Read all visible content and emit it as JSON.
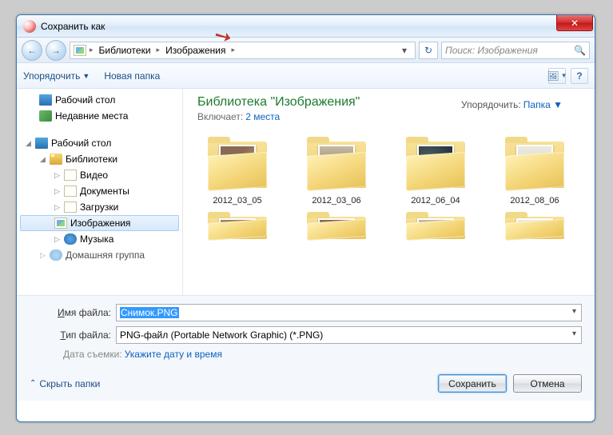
{
  "window": {
    "title": "Сохранить как"
  },
  "nav": {
    "segments": [
      "Библиотеки",
      "Изображения"
    ],
    "search_placeholder": "Поиск: Изображения"
  },
  "toolbar": {
    "organize": "Упорядочить",
    "new_folder": "Новая папка"
  },
  "sidebar": {
    "favorites": [
      {
        "label": "Рабочий стол",
        "icon": "desktop"
      },
      {
        "label": "Недавние места",
        "icon": "recent"
      }
    ],
    "desktop_root": "Рабочий стол",
    "libraries": "Библиотеки",
    "lib_items": [
      {
        "label": "Видео",
        "icon": "vid"
      },
      {
        "label": "Документы",
        "icon": "doc"
      },
      {
        "label": "Загрузки",
        "icon": "dl"
      },
      {
        "label": "Изображения",
        "icon": "pic",
        "selected": true
      },
      {
        "label": "Музыка",
        "icon": "mus"
      }
    ],
    "homegroup": "Домашняя группа"
  },
  "content": {
    "title": "Библиотека \"Изображения\"",
    "includes_label": "Включает:",
    "includes_link": "2 места",
    "arrange_label": "Упорядочить:",
    "arrange_value": "Папка",
    "folders": [
      "2012_03_05",
      "2012_03_06",
      "2012_06_04",
      "2012_08_06"
    ]
  },
  "fields": {
    "filename_label_pre": "",
    "filename_hot": "И",
    "filename_label_post": "мя файла:",
    "filetype_label_pre": "",
    "filetype_hot": "Т",
    "filetype_label_post": "ип файла:",
    "filename_value": "Снимок.PNG",
    "filetype_value": "PNG-файл (Portable Network Graphic) (*.PNG)",
    "meta_label": "Дата съемки:",
    "meta_link": "Укажите дату и время"
  },
  "footer": {
    "hide_folders": "Скрыть папки",
    "save": "Сохранить",
    "cancel": "Отмена"
  }
}
